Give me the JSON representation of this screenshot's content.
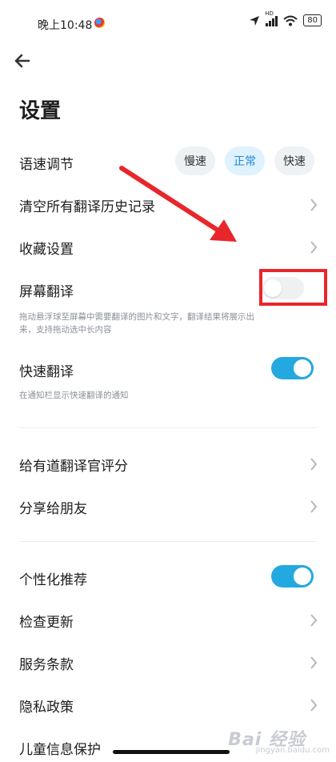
{
  "status_bar": {
    "time": "晚上10:48",
    "hd": "HD",
    "battery": "80"
  },
  "page": {
    "title": "设置"
  },
  "speed": {
    "label": "语速调节",
    "options": [
      "慢速",
      "正常",
      "快速"
    ],
    "selected": "正常"
  },
  "rows": {
    "clear_history": "清空所有翻译历史记录",
    "favorites": "收藏设置",
    "screen_translate": {
      "label": "屏幕翻译",
      "desc": "拖动悬浮球至屏幕中需要翻译的图片和文字，翻译结果将展示出来，支持拖动选中长内容",
      "enabled": false
    },
    "quick_translate": {
      "label": "快速翻译",
      "desc": "在通知栏显示快速翻译的通知",
      "enabled": true
    },
    "rate": "给有道翻译官评分",
    "share": "分享给朋友",
    "personalized": {
      "label": "个性化推荐",
      "enabled": true
    },
    "check_update": "检查更新",
    "terms": "服务条款",
    "privacy": "隐私政策",
    "child_privacy": "儿童信息保护"
  },
  "watermark": {
    "logo": "Bai  经验",
    "sub": "jingyan.baidu.com"
  },
  "colors": {
    "accent": "#24a8e0",
    "annotation_red": "#e8262b"
  }
}
